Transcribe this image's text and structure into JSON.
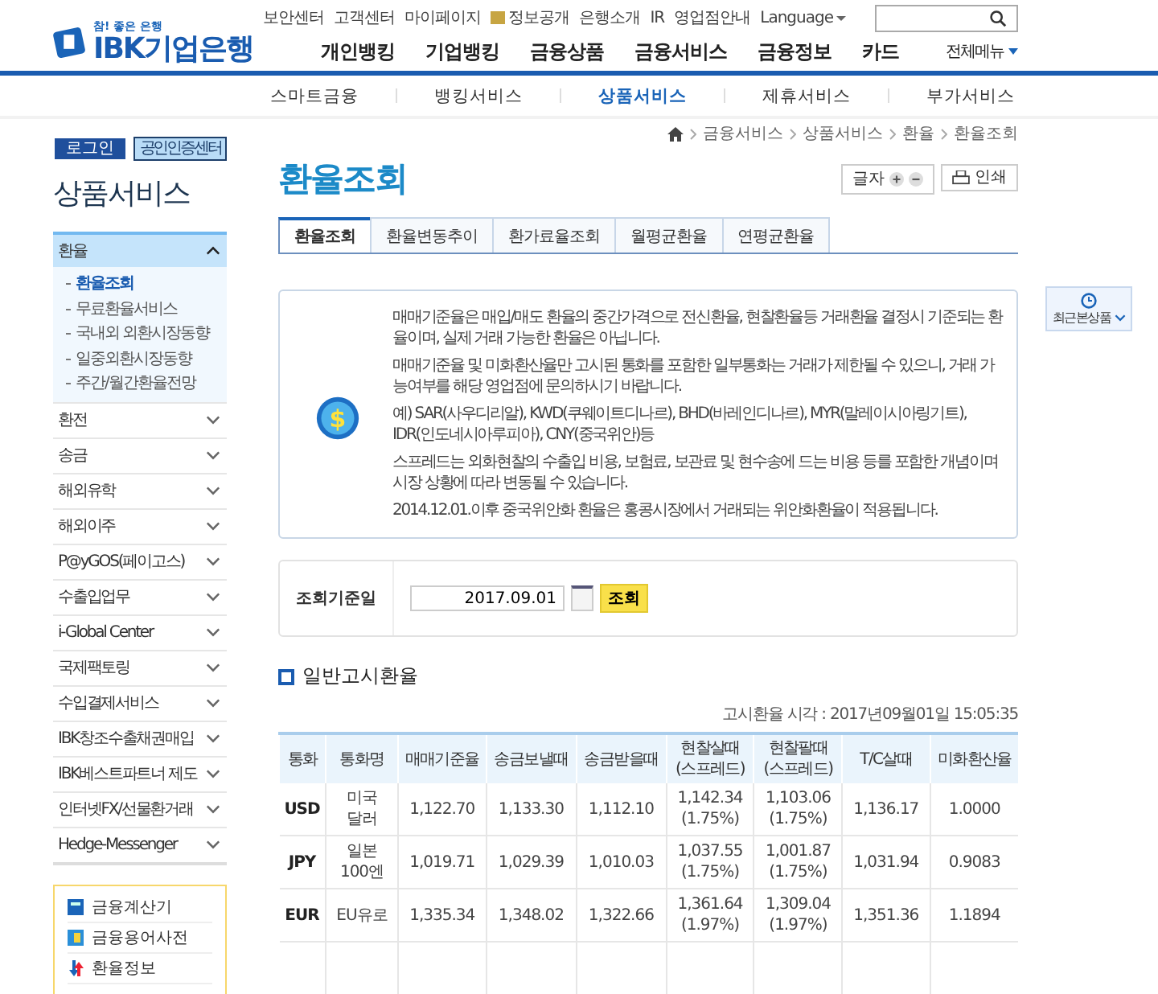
{
  "header": {
    "logo_tagline": "참! 좋은 은행",
    "logo_text": "IBK기업은행",
    "utility_links": [
      "보안센터",
      "고객센터",
      "마이페이지",
      "정보공개",
      "은행소개",
      "IR",
      "영업점안내",
      "Language"
    ],
    "main_nav": [
      "개인뱅킹",
      "기업뱅킹",
      "금융상품",
      "금융서비스",
      "금융정보",
      "카드"
    ],
    "all_menu": "전체메뉴"
  },
  "subnav": [
    {
      "label": "스마트금융",
      "selected": false
    },
    {
      "label": "뱅킹서비스",
      "selected": false
    },
    {
      "label": "상품서비스",
      "selected": true
    },
    {
      "label": "제휴서비스",
      "selected": false
    },
    {
      "label": "부가서비스",
      "selected": false
    }
  ],
  "sidebar": {
    "buttons": [
      "로그인",
      "공인인증센터"
    ],
    "title": "상품서비스",
    "items": [
      {
        "label": "환율",
        "expanded": true,
        "children": [
          {
            "label": "환율조회",
            "selected": true
          },
          {
            "label": "무료환율서비스",
            "selected": false
          },
          {
            "label": "국내외 외환시장동향",
            "selected": false
          },
          {
            "label": "일중외환시장동향",
            "selected": false
          },
          {
            "label": "주간/월간환율전망",
            "selected": false
          }
        ]
      },
      {
        "label": "환전",
        "expanded": false
      },
      {
        "label": "송금",
        "expanded": false
      },
      {
        "label": "해외유학",
        "expanded": false
      },
      {
        "label": "해외이주",
        "expanded": false
      },
      {
        "label": "P@yGOS(페이고스)",
        "expanded": false
      },
      {
        "label": "수출입업무",
        "expanded": false
      },
      {
        "label": "i-Global Center",
        "expanded": false
      },
      {
        "label": "국제팩토링",
        "expanded": false
      },
      {
        "label": "수입결제서비스",
        "expanded": false
      },
      {
        "label": "IBK창조수출채권매입",
        "expanded": false
      },
      {
        "label": "IBK베스트파트너 제도",
        "expanded": false
      },
      {
        "label": "인터넷FX/선물환거래",
        "expanded": false
      },
      {
        "label": "Hedge-Messenger",
        "expanded": false
      }
    ],
    "quick_links": [
      {
        "label": "금융계산기",
        "kind": "calculator"
      },
      {
        "label": "금융용어사전",
        "kind": "dictionary"
      },
      {
        "label": "환율정보",
        "kind": "exchange"
      }
    ]
  },
  "breadcrumb": [
    "금융서비스",
    "상품서비스",
    "환율",
    "환율조회"
  ],
  "page_title": "환율조회",
  "text_size_label": "글자",
  "print_label": "인쇄",
  "tabs": [
    {
      "label": "환율조회",
      "selected": true
    },
    {
      "label": "환율변동추이",
      "selected": false
    },
    {
      "label": "환가료율조회",
      "selected": false
    },
    {
      "label": "월평균환율",
      "selected": false
    },
    {
      "label": "연평균환율",
      "selected": false
    }
  ],
  "recent_widget": "최근본상품",
  "notice_icon": "$",
  "notice": [
    "매매기준율은 매입/매도 환율의 중간가격으로 전신환율, 현찰환율등 거래환율 결정시 기준되는 환율이며, 실제 거래 가능한 환율은 아닙니다.",
    "매매기준율 및 미화환산율만 고시된 통화를 포함한 일부통화는 거래가 제한될 수 있으니, 거래 가능여부를 해당 영업점에 문의하시기 바랍니다.",
    "예) SAR(사우디리알), KWD(쿠웨이트디나르), BHD(바레인디나르), MYR(말레이시아링기트), IDR(인도네시아루피아), CNY(중국위안)등",
    "스프레드는 외화현찰의 수출입 비용, 보험료, 보관료 및 현수송에 드는 비용 등를 포함한 개념이며 시장 상황에 따라 변동될 수 있습니다.",
    "2014.12.01.이후 중국위안화 환율은 홍콩시장에서 거래되는 위안화환율이 적용됩니다."
  ],
  "search": {
    "label": "조회기준일",
    "value": "2017.09.01",
    "button": "조회"
  },
  "section_title": "일반고시환율",
  "notice_time": "고시환율 시각 : 2017년09월01일 15:05:35",
  "table": {
    "columns": [
      {
        "lines": [
          "통화"
        ]
      },
      {
        "lines": [
          "통화명"
        ]
      },
      {
        "lines": [
          "매매기준율"
        ]
      },
      {
        "lines": [
          "송금보낼때"
        ]
      },
      {
        "lines": [
          "송금받을때"
        ]
      },
      {
        "lines": [
          "현찰살때",
          "(스프레드)"
        ]
      },
      {
        "lines": [
          "현찰팔때",
          "(스프레드)"
        ]
      },
      {
        "lines": [
          "T/C살때"
        ]
      },
      {
        "lines": [
          "미화환산율"
        ]
      }
    ],
    "rows": [
      [
        [
          "USD"
        ],
        [
          "미국",
          "달러"
        ],
        [
          "1,122.70"
        ],
        [
          "1,133.30"
        ],
        [
          "1,112.10"
        ],
        [
          "1,142.34",
          "(1.75%)"
        ],
        [
          "1,103.06",
          "(1.75%)"
        ],
        [
          "1,136.17"
        ],
        [
          "1.0000"
        ]
      ],
      [
        [
          "JPY"
        ],
        [
          "일본",
          "100엔"
        ],
        [
          "1,019.71"
        ],
        [
          "1,029.39"
        ],
        [
          "1,010.03"
        ],
        [
          "1,037.55",
          "(1.75%)"
        ],
        [
          "1,001.87",
          "(1.75%)"
        ],
        [
          "1,031.94"
        ],
        [
          "0.9083"
        ]
      ],
      [
        [
          "EUR"
        ],
        [
          "EU유로"
        ],
        [
          "1,335.34"
        ],
        [
          "1,348.02"
        ],
        [
          "1,322.66"
        ],
        [
          "1,361.64",
          "(1.97%)"
        ],
        [
          "1,309.04",
          "(1.97%)"
        ],
        [
          "1,351.36"
        ],
        [
          "1.1894"
        ]
      ]
    ]
  }
}
